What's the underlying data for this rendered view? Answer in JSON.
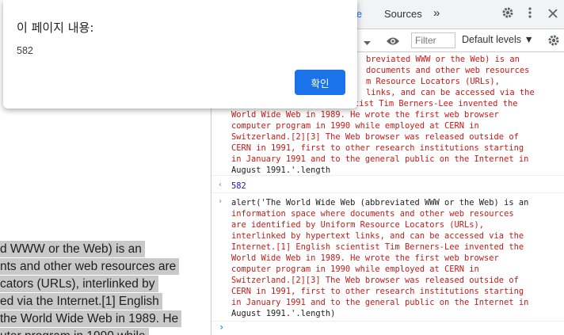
{
  "dialog": {
    "title": "이 페이지 내용:",
    "message": "582",
    "ok_label": "확인"
  },
  "devtools": {
    "tabs": [
      {
        "label": "le"
      },
      {
        "label": "Sources"
      },
      {
        "label": "»"
      }
    ],
    "filter_placeholder": "Filter",
    "levels_label": "Default levels ▼"
  },
  "page": {
    "selected_lines": [
      "d WWW or the Web) is an",
      "nts and other web resources are",
      "cators (URLs), interlinked by",
      "ed via the Internet.[1] English",
      " the World Wide Web in 1989. He",
      "uter program in 1990 while"
    ]
  },
  "console": {
    "entry1_lines": [
      "breviated WWW or the Web) is an",
      "documents and other web resources",
      "m Resource Locators (URLs),",
      "links, and can be accessed via the",
      "cientist Tim Berners-Lee invented the",
      "World Wide Web in 1989. He wrote the first web browser",
      "computer program in 1990 while employed at CERN in",
      "Switzerland.[2][3] The Web browser was released outside of",
      "CERN in 1991, first to other research institutions starting",
      "in January 1991 and to the general public on the Internet in",
      "August 1991.'.length"
    ],
    "result1": "582",
    "entry2_lines": [
      "alert('The World Wide Web (abbreviated WWW or the Web) is an",
      "information space where documents and other web resources",
      "are identified by Uniform Resource Locators (URLs),",
      "interlinked by hypertext links, and can be accessed via the",
      "Internet.[1] English scientist Tim Berners-Lee invented the",
      "World Wide Web in 1989. He wrote the first web browser",
      "computer program in 1990 while employed at CERN in",
      "Switzerland.[2][3] The Web browser was released outside of",
      "CERN in 1991, first to other research institutions starting",
      "in January 1991 and to the general public on the Internet in",
      "August 1991.'.length)"
    ],
    "result_arrow": "‹",
    "input_arrow": "›",
    "prompt_arrow": "›"
  }
}
